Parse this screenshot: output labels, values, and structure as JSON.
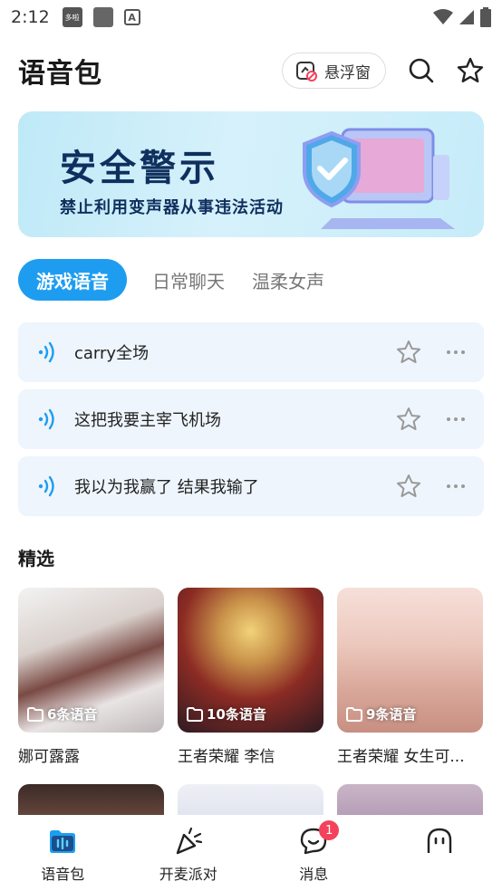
{
  "status_bar": {
    "time": "2:12",
    "app_badge": "多啦",
    "app_badge2": "A"
  },
  "header": {
    "title": "语音包",
    "float_label": "悬浮窗"
  },
  "banner": {
    "title": "安全警示",
    "subtitle": "禁止利用变声器从事违法活动"
  },
  "tabs": [
    {
      "label": "游戏语音",
      "active": true
    },
    {
      "label": "日常聊天",
      "active": false
    },
    {
      "label": "温柔女声",
      "active": false
    }
  ],
  "voices": [
    {
      "text": "carry全场"
    },
    {
      "text": "这把我要主宰飞机场"
    },
    {
      "text": "我以为我赢了 结果我输了"
    }
  ],
  "section": {
    "title": "精选"
  },
  "featured": [
    {
      "count": "6条语音",
      "name": "娜可露露"
    },
    {
      "count": "10条语音",
      "name": "王者荣耀 李信"
    },
    {
      "count": "9条语音",
      "name": "王者荣耀 女生可..."
    }
  ],
  "tabbar": [
    {
      "label": "语音包",
      "icon": "voice-pack-icon"
    },
    {
      "label": "开麦派对",
      "icon": "party-icon"
    },
    {
      "label": "消息",
      "icon": "message-icon",
      "badge": "1"
    },
    {
      "label": "",
      "icon": "profile-icon"
    }
  ],
  "colors": {
    "accent": "#1e9df0",
    "item_bg": "#eef5fc",
    "badge": "#f4425a",
    "banner_text": "#0f2f5e"
  }
}
